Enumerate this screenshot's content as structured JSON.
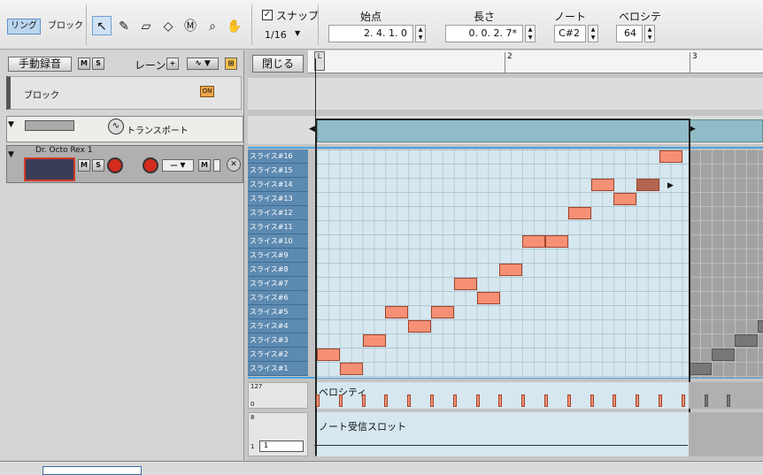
{
  "toolbar": {
    "mode_ring": "リング",
    "mode_block": "ブロック",
    "snap_label": "スナップ",
    "snap_value": "1/16",
    "start_label": "始点",
    "start_value": "2. 4. 1.   0",
    "length_label": "長さ",
    "length_value": "0. 0. 2.   7*",
    "note_label": "ノート",
    "note_value": "C#2",
    "velocity_label": "ベロシティ",
    "velocity_value": "64"
  },
  "left_panel": {
    "manual_rec": "手動録音",
    "mute": "M",
    "solo": "S",
    "lane_label": "レーン",
    "add_lane": "+",
    "close": "閉じる",
    "block_label": "ブロック",
    "on_label": "ON",
    "transport_label": "トランスポート",
    "device_name": "Dr. Octo Rex 1"
  },
  "ruler": {
    "bar_numbers": [
      "2",
      "3"
    ],
    "locator": "L"
  },
  "slices": [
    "スライス#16",
    "スライス#15",
    "スライス#14",
    "スライス#13",
    "スライス#12",
    "スライス#11",
    "スライス#10",
    "スライス#9",
    "スライス#8",
    "スライス#7",
    "スライス#6",
    "スライス#5",
    "スライス#4",
    "スライス#3",
    "スライス#2",
    "スライス#1"
  ],
  "lanes": {
    "velocity_label": "ベロシティ",
    "vel_max": "127",
    "vel_min": "0",
    "slot_label": "ノート受信スロット",
    "slot_max": "8",
    "slot_min": "1",
    "slot_value": "1"
  },
  "colors": {
    "note": "#f59075",
    "selected_note": "#b2654f",
    "roll_bg": "#d6e7ef",
    "slice_label_bg": "#5d8ab0"
  }
}
